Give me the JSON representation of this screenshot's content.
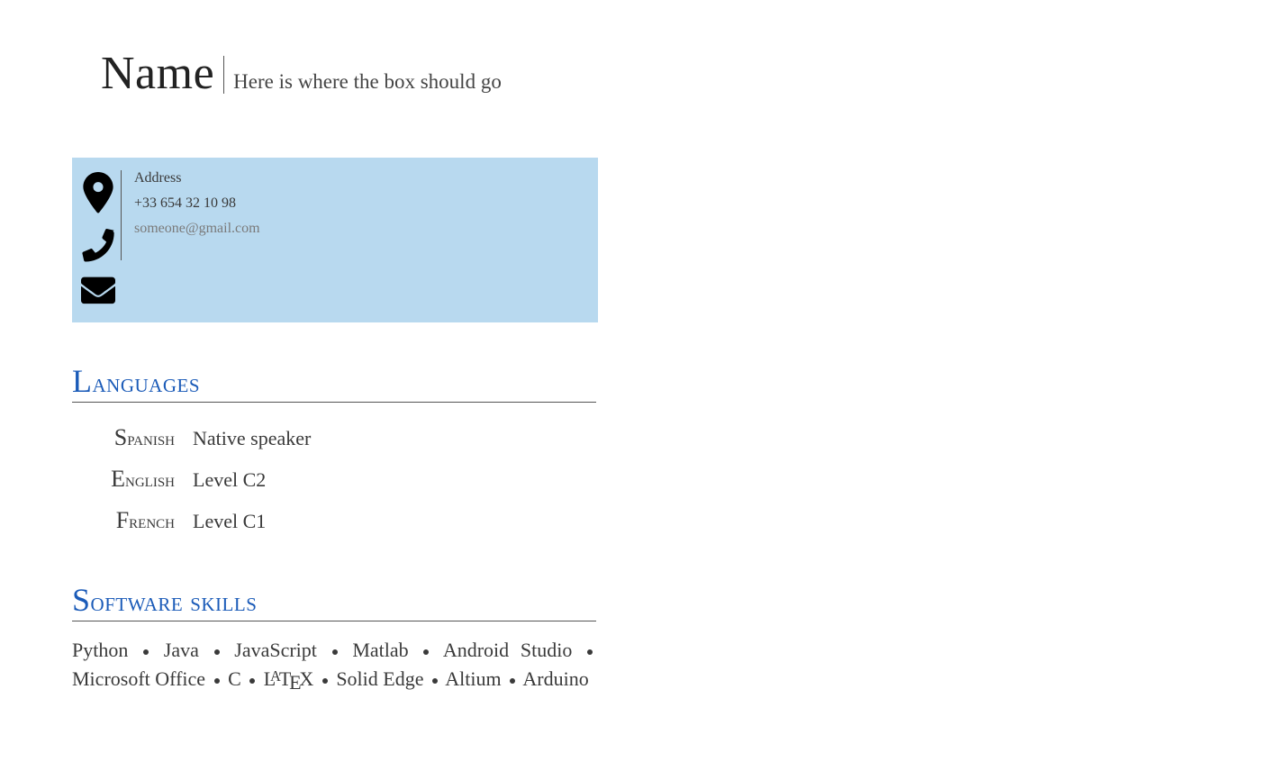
{
  "header": {
    "name": "Name",
    "tagline": "Here is where the box should go"
  },
  "contact": {
    "address": "Address",
    "phone": "+33 654 32 10 98",
    "email": "someone@gmail.com"
  },
  "sections": {
    "languages": {
      "title": "Languages",
      "items": [
        {
          "name": "Spanish",
          "level": "Native speaker"
        },
        {
          "name": "English",
          "level": "Level C2"
        },
        {
          "name": "French",
          "level": "Level C1"
        }
      ]
    },
    "software": {
      "title": "Software skills",
      "items": [
        "Python",
        "Java",
        "JavaScript",
        "Matlab",
        "Android Studio",
        "Microsoft Office",
        "C",
        "LaTeX",
        "Solid Edge",
        "Altium",
        "Arduino"
      ]
    }
  }
}
